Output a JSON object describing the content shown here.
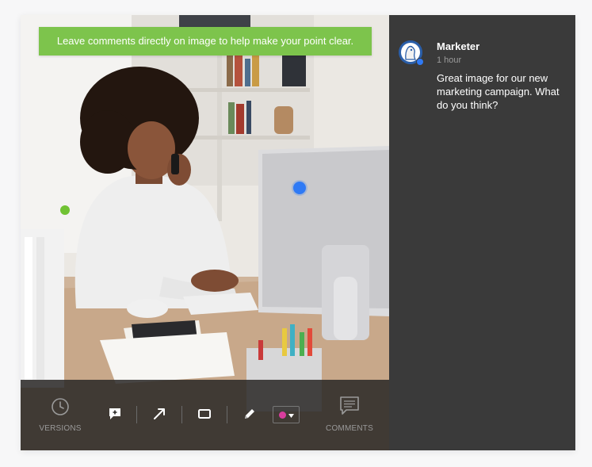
{
  "banner": {
    "text": "Leave comments directly on image to help make your point clear."
  },
  "toolbar": {
    "versions_label": "VERSIONS",
    "comments_label": "COMMENTS",
    "tools": [
      "add-comment",
      "arrow",
      "rectangle",
      "pen"
    ],
    "selected_color": "#d93d9e"
  },
  "comment": {
    "author": "Marketer",
    "time": "1 hour",
    "text": "Great image for our new marketing campaign. What do you think?"
  },
  "colors": {
    "banner_green": "#7dc44c",
    "marker_green": "#70c233",
    "marker_blue": "#2f7af5",
    "panel_bg": "#3a3a3a"
  }
}
